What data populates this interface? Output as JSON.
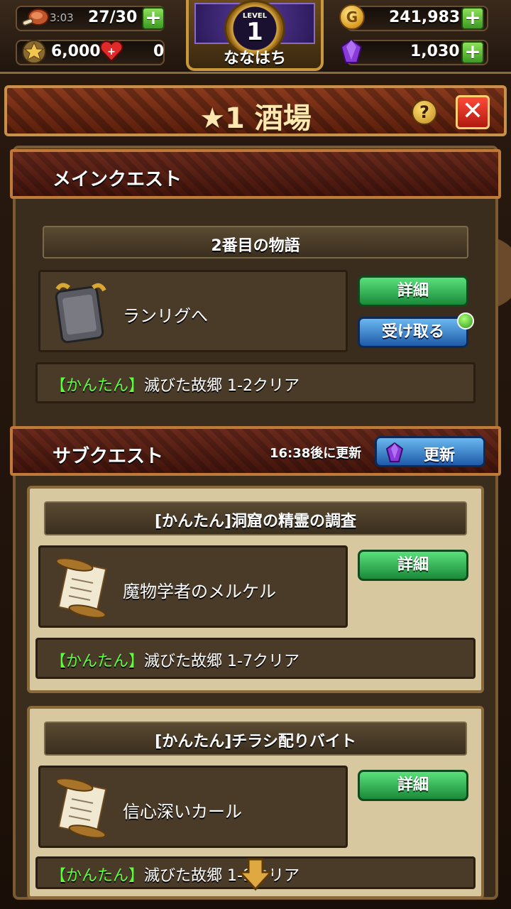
{
  "status": {
    "stamina_timer": "3:03",
    "stamina": "27/30",
    "gold": "241,983",
    "rank_points": "6,000",
    "hearts": "0",
    "gems": "1,030"
  },
  "player": {
    "level_label": "LEVEL",
    "level": "1",
    "name": "ななはち"
  },
  "title": "★1 酒場",
  "help_label": "?",
  "close_label": "✕",
  "main_quest": {
    "header": "メインクエスト",
    "chapter": "2番目の物語",
    "quest_name": "ランリグへ",
    "detail_label": "詳細",
    "receive_label": "受け取る",
    "difficulty": "【かんたん】",
    "condition": "滅びた故郷 1-2クリア"
  },
  "sub_quest": {
    "header": "サブクエスト",
    "refresh_time": "16:38後に更新",
    "refresh_label": "更新",
    "items": [
      {
        "title": "[かんたん]洞窟の精霊の調査",
        "quest_name": "魔物学者のメルケル",
        "detail_label": "詳細",
        "difficulty": "【かんたん】",
        "condition": "滅びた故郷 1-7クリア"
      },
      {
        "title": "[かんたん]チラシ配りバイト",
        "quest_name": "信心深いカール",
        "detail_label": "詳細",
        "difficulty": "【かんたん】",
        "condition": "滅びた故郷 1-9クリア"
      }
    ]
  }
}
